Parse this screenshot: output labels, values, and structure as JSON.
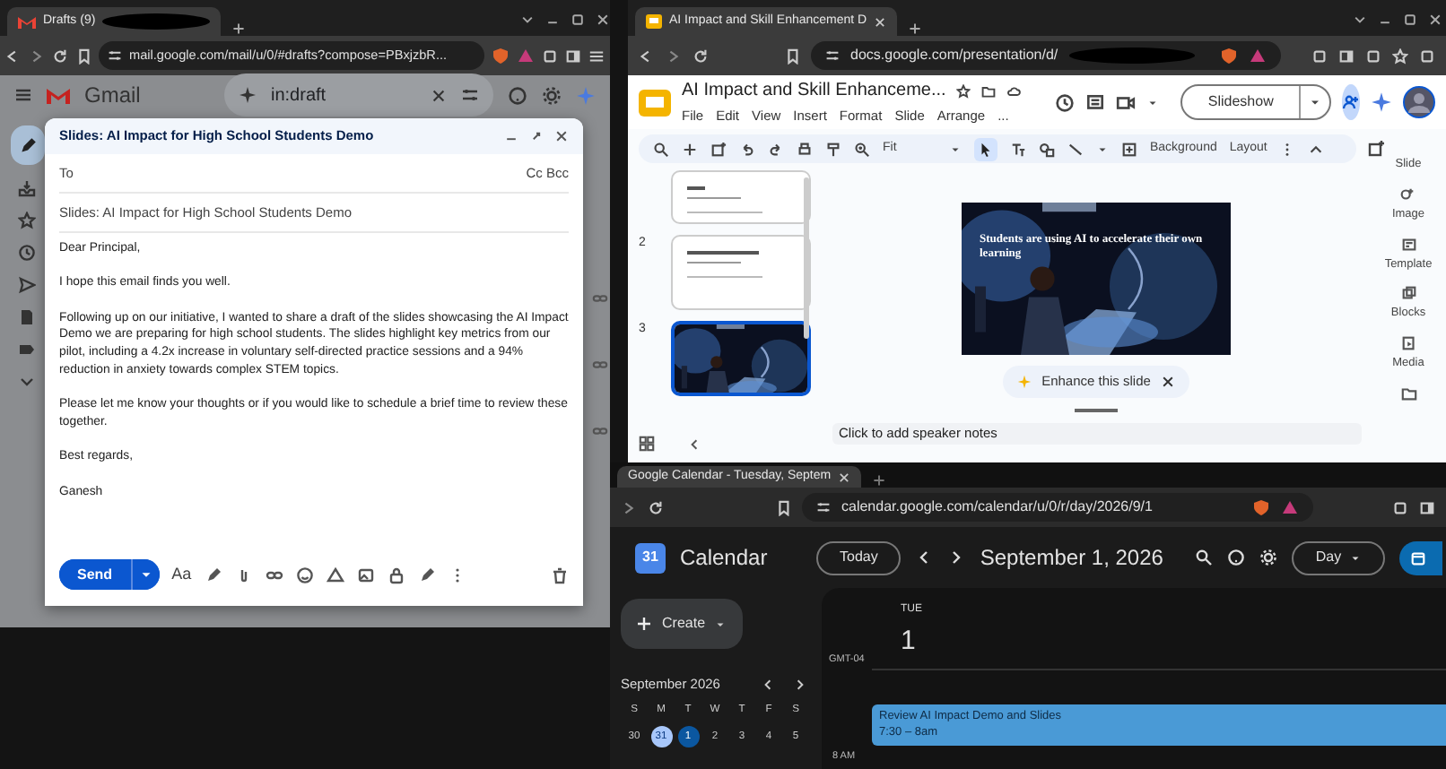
{
  "gmail_window": {
    "tab_title": "Drafts (9)",
    "url": "mail.google.com/mail/u/0/#drafts?compose=PBxjzbR...",
    "app_name": "Gmail",
    "search": {
      "value": "in:draft"
    },
    "compose": {
      "title": "Slides: AI Impact for High School Students Demo",
      "to_label": "To",
      "cc_bcc": "Cc Bcc",
      "subject": "Slides: AI Impact for High School Students Demo",
      "body": [
        "Dear Principal,",
        "I hope this email finds you well.",
        "Following up on our initiative, I wanted to share a draft of the slides showcasing the AI Impact Demo we are preparing for high school students. The slides highlight key metrics from our pilot, including a 4.2x increase in voluntary self-directed practice sessions and a 94% reduction in anxiety towards complex STEM topics.",
        "Please let me know your thoughts or if you would like to schedule a brief time to review these together.",
        "Best regards,",
        "Ganesh"
      ],
      "send": "Send",
      "format_label": "Aa"
    }
  },
  "slides_window": {
    "tab_title": "AI Impact and Skill Enhancement D",
    "url": "docs.google.com/presentation/d/",
    "doc_title": "AI Impact and Skill Enhanceme...",
    "menus": [
      "File",
      "Edit",
      "View",
      "Insert",
      "Format",
      "Slide",
      "Arrange",
      "..."
    ],
    "slideshow": "Slideshow",
    "zoom": "Fit",
    "background": "Background",
    "layout": "Layout",
    "thumbnails": [
      {
        "kind": "light",
        "selected": false
      },
      {
        "number": "2",
        "kind": "light",
        "selected": false
      },
      {
        "number": "3",
        "kind": "dark",
        "selected": true
      }
    ],
    "slide_title": "Students are using AI to accelerate their own learning",
    "enhance": "Enhance this slide",
    "notes_placeholder": "Click to add speaker notes",
    "side_panel": [
      "Slide",
      "Image",
      "Template",
      "Blocks",
      "Media"
    ]
  },
  "calendar_window": {
    "tab_title": "Google Calendar - Tuesday, Septem",
    "url": "calendar.google.com/calendar/u/0/r/day/2026/9/1",
    "logo_number": "31",
    "app_name": "Calendar",
    "today": "Today",
    "date_title": "September 1, 2026",
    "view": "Day",
    "create": "Create",
    "mini": {
      "title": "September 2026",
      "weekdays": [
        "S",
        "M",
        "T",
        "W",
        "T",
        "F",
        "S"
      ],
      "days": [
        {
          "label": "30",
          "kind": "plain"
        },
        {
          "label": "31",
          "kind": "ringed"
        },
        {
          "label": "1",
          "kind": "filled"
        },
        {
          "label": "2",
          "kind": "plain"
        },
        {
          "label": "3",
          "kind": "plain"
        },
        {
          "label": "4",
          "kind": "plain"
        },
        {
          "label": "5",
          "kind": "plain"
        }
      ]
    },
    "day": {
      "weekday": "TUE",
      "date": "1",
      "timezone": "GMT-04",
      "time_label": "8 AM"
    },
    "event": {
      "title": "Review AI Impact Demo and Slides",
      "time": "7:30 – 8am"
    }
  }
}
